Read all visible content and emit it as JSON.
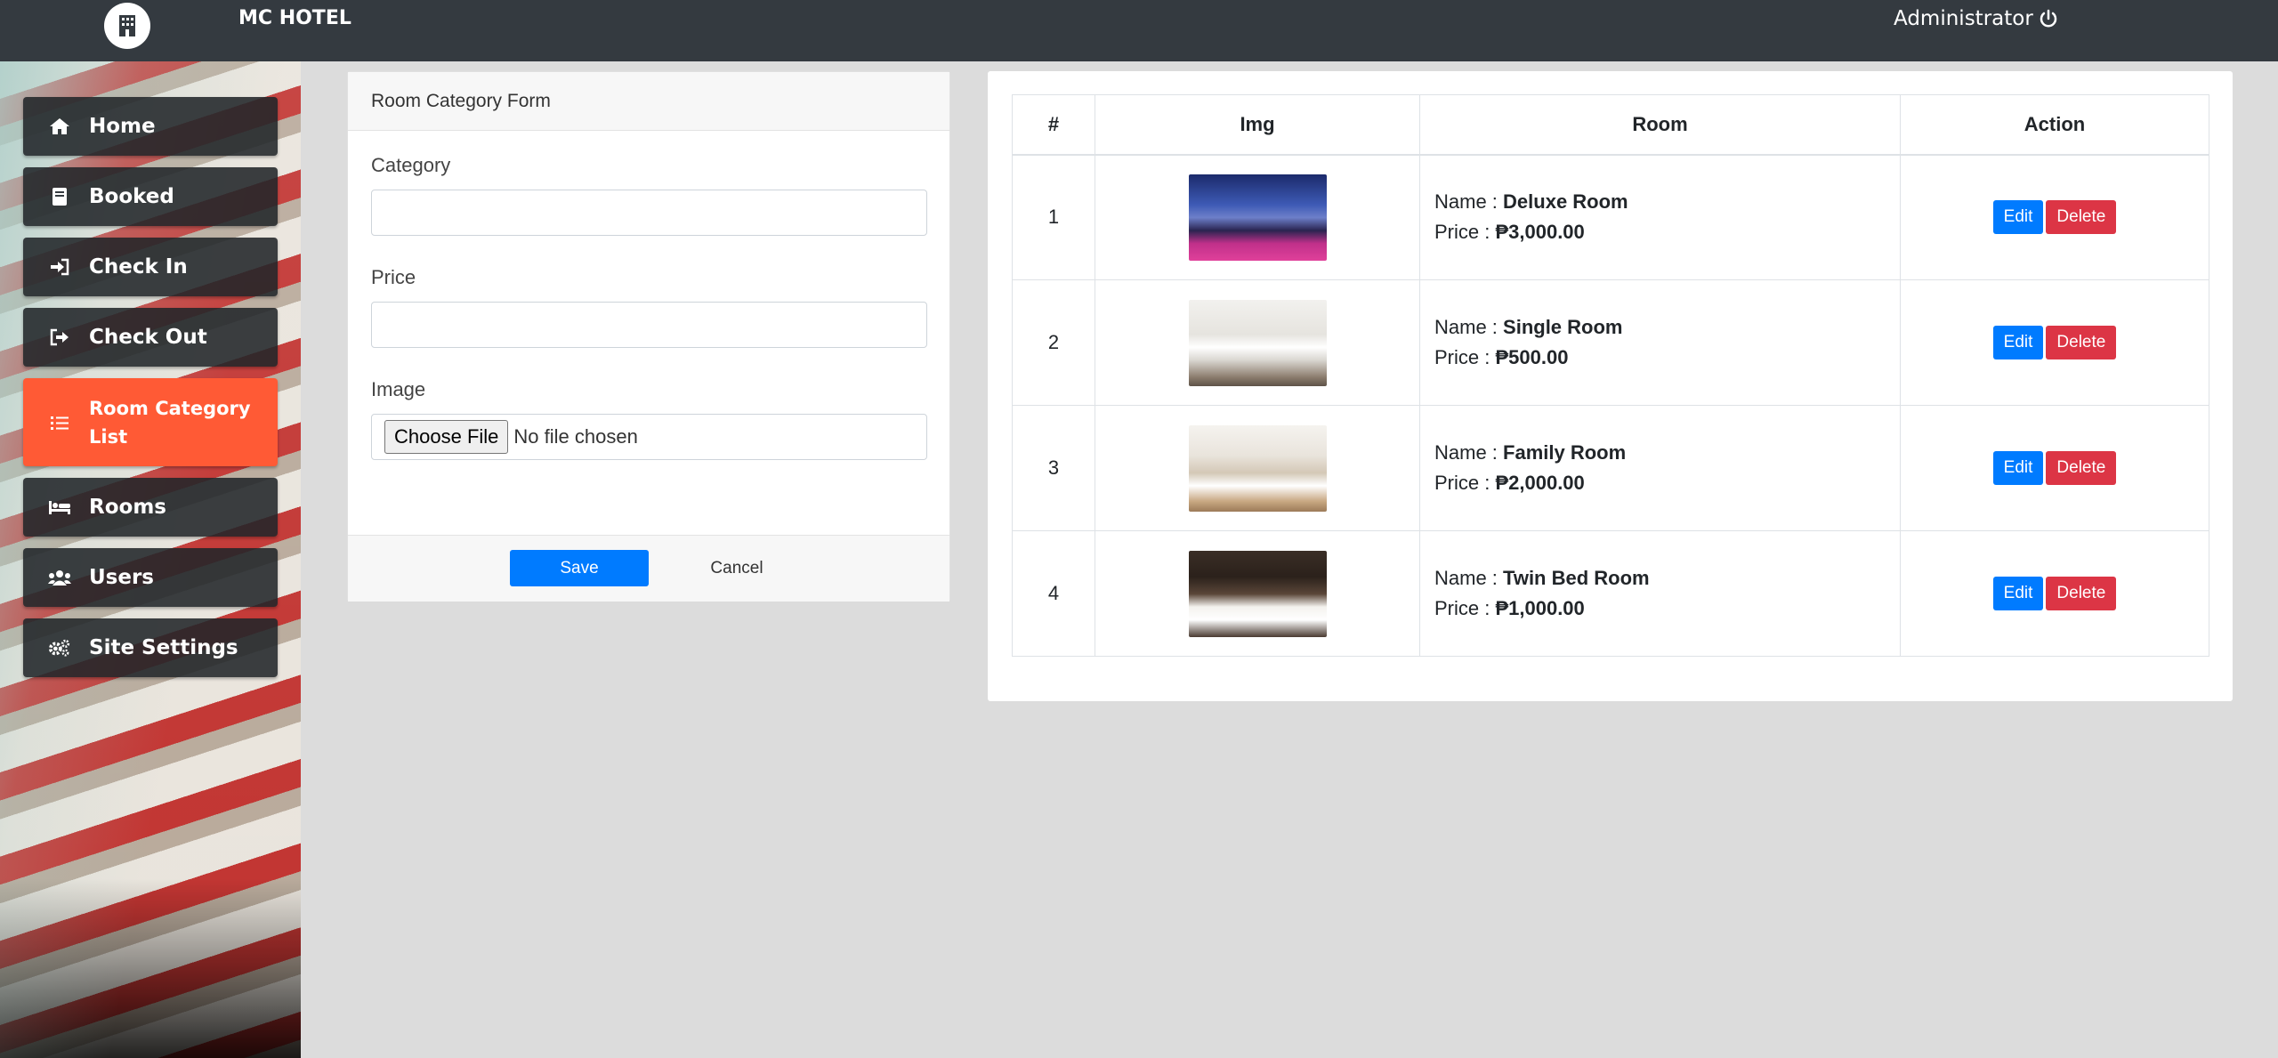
{
  "header": {
    "brand": "MC HOTEL",
    "user_label": "Administrator",
    "user_icon": "power-icon"
  },
  "sidebar": {
    "items": [
      {
        "label": "Home",
        "icon": "home-icon"
      },
      {
        "label": "Booked",
        "icon": "book-icon"
      },
      {
        "label": "Check In",
        "icon": "sign-in-icon"
      },
      {
        "label": "Check Out",
        "icon": "sign-out-icon"
      },
      {
        "label": "Room Category List",
        "icon": "list-icon",
        "active": true
      },
      {
        "label": "Rooms",
        "icon": "bed-icon"
      },
      {
        "label": "Users",
        "icon": "users-icon"
      },
      {
        "label": "Site Settings",
        "icon": "cogs-icon"
      }
    ]
  },
  "form": {
    "title": "Room Category Form",
    "category_label": "Category",
    "category_value": "",
    "price_label": "Price",
    "price_value": "",
    "image_label": "Image",
    "choose_file_label": "Choose File",
    "no_file_text": "No file chosen",
    "save_label": "Save",
    "cancel_label": "Cancel"
  },
  "table": {
    "headers": [
      "#",
      "Img",
      "Room",
      "Action"
    ],
    "name_prefix": "Name : ",
    "price_prefix": "Price : ",
    "edit_label": "Edit",
    "delete_label": "Delete",
    "rows": [
      {
        "num": "1",
        "name": "Deluxe Room",
        "price": "₱3,000.00"
      },
      {
        "num": "2",
        "name": "Single Room",
        "price": "₱500.00"
      },
      {
        "num": "3",
        "name": "Family Room",
        "price": "₱2,000.00"
      },
      {
        "num": "4",
        "name": "Twin Bed Room",
        "price": "₱1,000.00"
      }
    ]
  },
  "colors": {
    "topbar": "#343a40",
    "active_nav": "#ff5a35",
    "primary": "#007bff",
    "danger": "#dc3545"
  }
}
